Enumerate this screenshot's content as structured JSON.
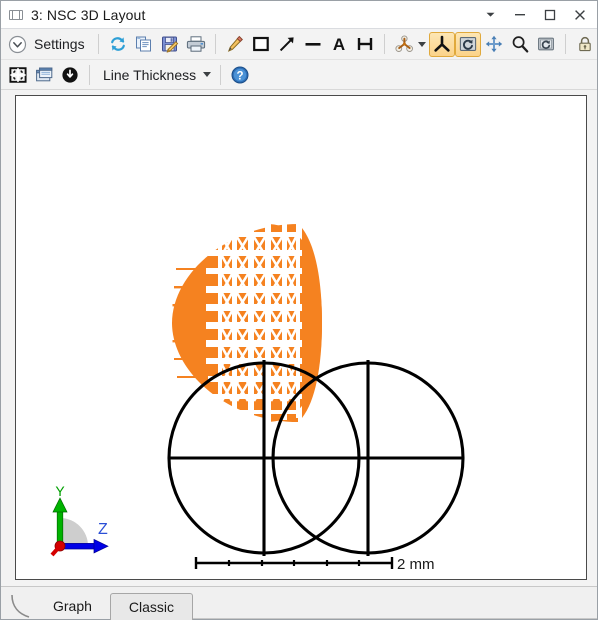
{
  "window": {
    "title": "3: NSC 3D Layout",
    "icon": "layout-window-icon",
    "controls": {
      "dropdown": "▼",
      "minimize": "–",
      "maximize": "□",
      "close": "✕"
    }
  },
  "toolbar_primary": {
    "settings_label": "Settings",
    "items": [
      {
        "name": "settings-button",
        "label": "Settings",
        "icon": "chevron-down-circle-icon"
      },
      {
        "name": "refresh-button",
        "label": "Update",
        "icon": "refresh-icon"
      },
      {
        "name": "copy-button",
        "label": "Copy",
        "icon": "copy-icon"
      },
      {
        "name": "save-button",
        "label": "Save",
        "icon": "save-disk-icon"
      },
      {
        "name": "print-button",
        "label": "Print",
        "icon": "printer-icon"
      },
      {
        "name": "annotate-pen-button",
        "label": "Pen",
        "icon": "pencil-icon"
      },
      {
        "name": "draw-rectangle-button",
        "label": "Rectangle",
        "icon": "square-icon"
      },
      {
        "name": "draw-arrow-button",
        "label": "Arrow",
        "icon": "arrow-diagonal-icon"
      },
      {
        "name": "draw-line-button",
        "label": "Line",
        "icon": "line-icon"
      },
      {
        "name": "text-annotation-button",
        "label": "Text",
        "icon": "letter-a-icon"
      },
      {
        "name": "dimension-button",
        "label": "Dimension",
        "icon": "dimension-h-icon"
      },
      {
        "name": "view-orientation-button",
        "label": "View",
        "icon": "tripod-shaded-icon"
      },
      {
        "name": "axis-tripod-button",
        "label": "Axis",
        "icon": "tripod-icon",
        "active": true
      },
      {
        "name": "rotate-button",
        "label": "Rotate",
        "icon": "rotate-icon",
        "active": true
      },
      {
        "name": "pan-button",
        "label": "Pan",
        "icon": "pan-arrows-icon"
      },
      {
        "name": "zoom-button",
        "label": "Zoom",
        "icon": "magnifier-icon"
      },
      {
        "name": "reset-view-button",
        "label": "Reset View",
        "icon": "reset-view-icon"
      },
      {
        "name": "lock-button",
        "label": "Lock",
        "icon": "padlock-icon"
      }
    ]
  },
  "toolbar_secondary": {
    "line_thickness_label": "Line Thickness",
    "items": [
      {
        "name": "fit-window-button",
        "label": "Fit",
        "icon": "fit-window-icon"
      },
      {
        "name": "layers-button",
        "label": "Layers",
        "icon": "layers-window-icon"
      },
      {
        "name": "clock-button",
        "label": "Animate",
        "icon": "clock-down-icon"
      },
      {
        "name": "line-thickness-dropdown",
        "label": "Line Thickness",
        "icon": "chevron-down-icon"
      },
      {
        "name": "help-button",
        "label": "Help",
        "icon": "question-circle-icon"
      }
    ]
  },
  "canvas": {
    "scale_bar": {
      "label": "2 mm",
      "tick_count": 5
    },
    "axis_indicator": {
      "y_label": "Y",
      "z_label": "Z",
      "y_color": "#00b300",
      "z_color": "#0000e6",
      "x_color": "#d40000"
    },
    "model_color": "#f58220",
    "outline_color": "#000000"
  },
  "tabs": {
    "items": [
      {
        "name": "tab-graph",
        "label": "Graph",
        "selected": false
      },
      {
        "name": "tab-classic",
        "label": "Classic",
        "selected": true
      }
    ]
  },
  "colors": {
    "accent_orange": "#f58220",
    "active_button": "#fbd38a",
    "toolbar_bg": "#f3f3f3",
    "canvas_bg": "#ffffff"
  }
}
